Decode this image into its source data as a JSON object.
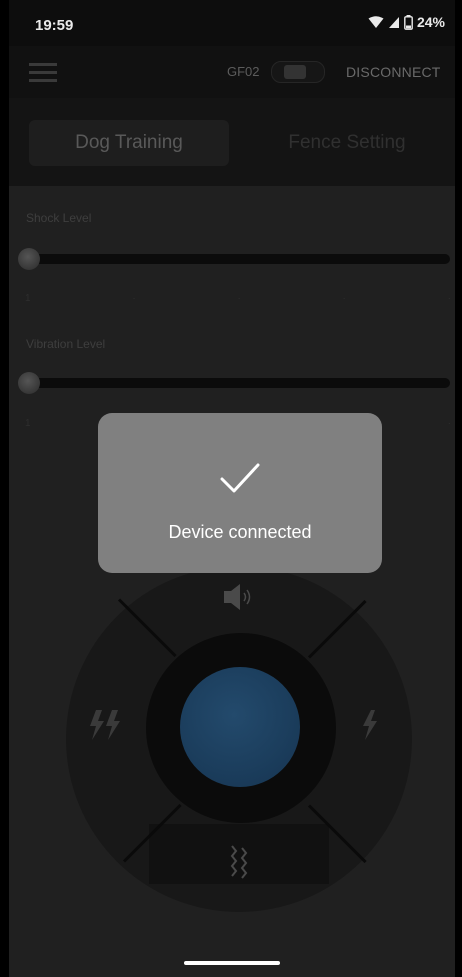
{
  "status_bar": {
    "time": "19:59",
    "battery_text": "24%",
    "icons": [
      "wifi-icon",
      "signal-icon",
      "battery-icon"
    ]
  },
  "app_bar": {
    "menu_icon": "hamburger-menu-icon",
    "device_name": "GF02",
    "disconnect_label": "DISCONNECT"
  },
  "tabs": [
    {
      "label": "Dog Training",
      "active": true
    },
    {
      "label": "Fence Setting",
      "active": false
    }
  ],
  "sliders": [
    {
      "label": "Shock Level",
      "value": 1,
      "min": 1,
      "max": 5,
      "ticks": [
        "1",
        "",
        "",
        "",
        ""
      ]
    },
    {
      "label": "Vibration Level",
      "value": 1,
      "min": 1,
      "max": 5,
      "ticks": [
        "1",
        "",
        "",
        "",
        ""
      ]
    }
  ],
  "controls": {
    "top": "speaker-icon",
    "left": "double-lightning-icon",
    "right": "lightning-icon",
    "bottom": "vibration-icon",
    "center": "action-button"
  },
  "toast": {
    "icon": "checkmark-icon",
    "message": "Device connected"
  },
  "colors": {
    "accent_blue": "#1b3d5c",
    "toast_bg": "#808080",
    "background": "#202020"
  }
}
